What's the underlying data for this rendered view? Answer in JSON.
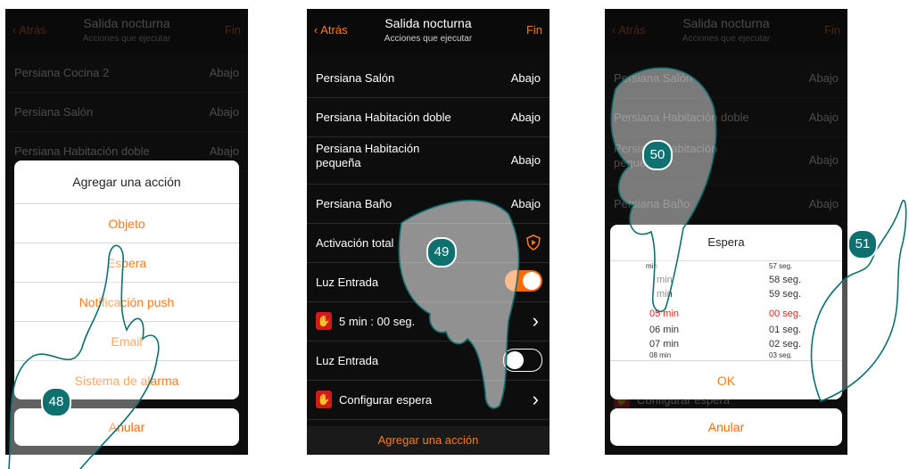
{
  "screen1": {
    "header": {
      "back": "Atrás",
      "title": "Salida nocturna",
      "subtitle": "Acciones que ejecutar",
      "done": "Fin"
    },
    "rows": [
      {
        "label": "Persiana Cocina 2",
        "value": "Abajo"
      },
      {
        "label": "Persiana Salón",
        "value": "Abajo"
      },
      {
        "label": "Persiana Habitación doble",
        "value": "Abajo"
      }
    ],
    "sheet": {
      "title": "Agregar una acción",
      "items": [
        "Objeto",
        "Espera",
        "Notificación push",
        "Email",
        "Sistema de alarma"
      ]
    },
    "cancel": "Anular",
    "step": "48"
  },
  "screen2": {
    "header": {
      "back": "Atrás",
      "title": "Salida nocturna",
      "subtitle": "Acciones que ejecutar",
      "done": "Fin"
    },
    "rows": [
      {
        "label": "Persiana Salón",
        "value": "Abajo"
      },
      {
        "label": "Persiana Habitación doble",
        "value": "Abajo"
      },
      {
        "label": "Persiana Habitación pequeña",
        "value": "Abajo"
      },
      {
        "label": "Persiana Baño",
        "value": "Abajo"
      },
      {
        "label": "Activación total"
      },
      {
        "label": "Luz Entrada",
        "toggle": "on"
      },
      {
        "label": "5 min : 00 seg."
      },
      {
        "label": "Luz Entrada",
        "toggle": "off"
      },
      {
        "label": "Configurar espera"
      }
    ],
    "footer": "Agregar una acción",
    "step": "49"
  },
  "screen3": {
    "header": {
      "back": "Atrás",
      "title": "Salida nocturna",
      "subtitle": "Acciones que ejecutar",
      "done": "Fin"
    },
    "rows": [
      {
        "label": "Persiana Salón",
        "value": "Abajo"
      },
      {
        "label": "Persiana Habitación doble",
        "value": "Abajo"
      },
      {
        "label": "Persiana Habitación pequeña",
        "value": "Abajo"
      },
      {
        "label": "Persiana Baño",
        "value": "Abajo"
      },
      {
        "label": "Configurar espera"
      }
    ],
    "dialog": {
      "title": "Espera",
      "minutes": [
        "min",
        "min",
        "min",
        "05 min",
        "06 min",
        "07 min",
        "08 min"
      ],
      "seconds": [
        "57 seg.",
        "58 seg.",
        "59 seg.",
        "00 seg.",
        "01 seg.",
        "02 seg.",
        "03 seg."
      ],
      "ok": "OK"
    },
    "cancel": "Anular",
    "steps": [
      "50",
      "51"
    ]
  },
  "colors": {
    "accent": "#ff7a1a",
    "background": "#0d0d0d",
    "badge": "#0f7070",
    "selected": "#e02020"
  }
}
